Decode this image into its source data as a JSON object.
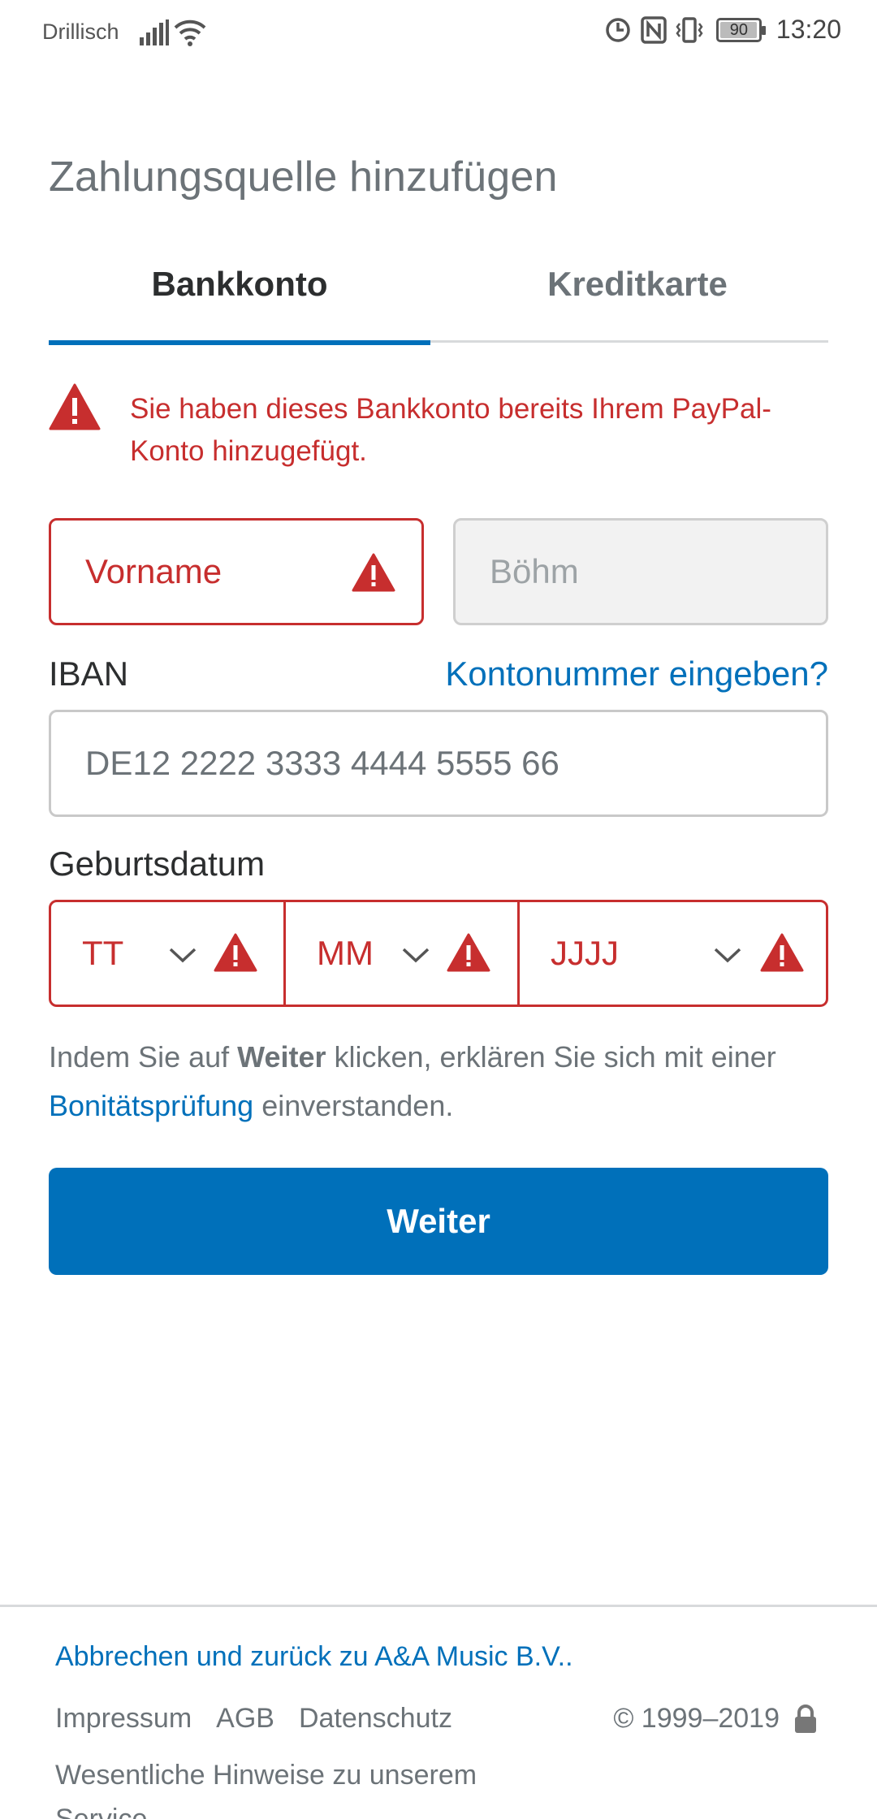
{
  "status_bar": {
    "carrier": "Drillisch",
    "battery": "90",
    "time": "13:20"
  },
  "page": {
    "title": "Zahlungsquelle hinzufügen"
  },
  "tabs": [
    {
      "label": "Bankkonto",
      "active": true
    },
    {
      "label": "Kreditkarte",
      "active": false
    }
  ],
  "alert": {
    "message": "Sie haben dieses Bankkonto bereits Ihrem PayPal-Konto hinzugefügt.",
    "color": "#c72e2e"
  },
  "form": {
    "first_name_placeholder": "Vorname",
    "last_name_value": "Böhm",
    "iban_label": "IBAN",
    "account_number_link": "Kontonummer eingeben?",
    "iban_placeholder": "DE12 2222 3333 4444 5555 66",
    "birthdate_label": "Geburtsdatum",
    "day_placeholder": "TT",
    "month_placeholder": "MM",
    "year_placeholder": "JJJJ"
  },
  "consent": {
    "part1": "Indem Sie auf ",
    "bold": "Weiter",
    "part2": " klicken, erklären Sie sich mit einer ",
    "link": "Bonitätsprüfung",
    "part3": " einverstanden."
  },
  "primary_button": "Weiter",
  "footer": {
    "cancel_link": "Abbrechen und zurück zu A&A Music B.V..",
    "links": [
      "Impressum",
      "AGB",
      "Datenschutz"
    ],
    "copyright": "© 1999–2019",
    "notice_line1": "Wesentliche Hinweise zu unserem",
    "notice_line2": "Service"
  },
  "colors": {
    "brand_blue": "#0070ba",
    "error_red": "#c72e2e",
    "muted_text": "#6c7378"
  },
  "icons": {
    "signal": "signal-icon",
    "wifi": "wifi-icon",
    "warning": "warning-icon",
    "chevron": "chevron-down-icon",
    "lock": "lock-icon"
  }
}
